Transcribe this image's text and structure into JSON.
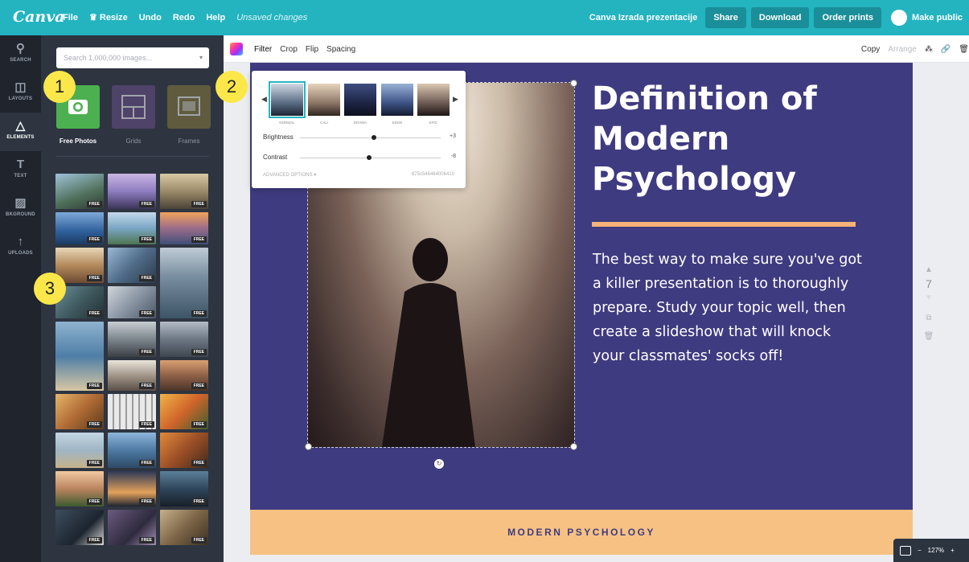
{
  "app": {
    "logo": "Canva"
  },
  "menu": {
    "file": "File",
    "resize": "Resize",
    "undo": "Undo",
    "redo": "Redo",
    "help": "Help",
    "status": "Unsaved changes"
  },
  "topbar_right": {
    "doc_title": "Canva Izrada prezentacije",
    "share": "Share",
    "download": "Download",
    "order_prints": "Order prints",
    "make_public": "Make public"
  },
  "rail": [
    {
      "label": "SEARCH",
      "icon": "search-icon"
    },
    {
      "label": "LAYOUTS",
      "icon": "layouts-icon"
    },
    {
      "label": "ELEMENTS",
      "icon": "elements-icon"
    },
    {
      "label": "TEXT",
      "icon": "text-icon"
    },
    {
      "label": "BKGROUND",
      "icon": "background-icon"
    },
    {
      "label": "UPLOADS",
      "icon": "uploads-icon"
    }
  ],
  "panel": {
    "search_placeholder": "Search 1,000,000 images...",
    "categories": [
      "Free Photos",
      "Grids",
      "Frames"
    ],
    "free_badge": "FREE"
  },
  "toolbar": {
    "filter": "Filter",
    "crop": "Crop",
    "flip": "Flip",
    "spacing": "Spacing",
    "copy": "Copy",
    "arrange": "Arrange"
  },
  "filter_popup": {
    "filters": [
      "NORMAL",
      "CALI",
      "DRAMA",
      "EDGE",
      "EPIC"
    ],
    "brightness_label": "Brightness",
    "brightness_value": "+3",
    "contrast_label": "Contrast",
    "contrast_value": "-8",
    "advanced": "ADVANCED OPTIONS ▾",
    "hex": "675c546464006410"
  },
  "slide": {
    "title": "Definition of Modern Psychology",
    "body": "The best way to make sure you've got a killer presentation is to thoroughly prepare. Study your topic well, then create a slideshow that will knock your classmates' socks off!",
    "footer": "MODERN PSYCHOLOGY"
  },
  "page_controls": {
    "page_number": "7"
  },
  "zoom": {
    "level": "127%"
  },
  "markers": [
    "1",
    "2",
    "3"
  ],
  "colors": {
    "topbar": "#23b4c0",
    "slide_bg": "#3f3b80",
    "accent_orange": "#f6b377",
    "marker_yellow": "#fce74a"
  }
}
